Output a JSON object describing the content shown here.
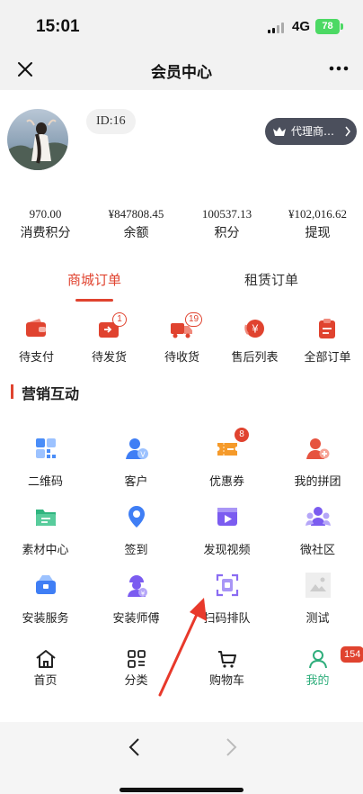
{
  "status_bar": {
    "time": "15:01",
    "network": "4G",
    "battery": "78"
  },
  "nav": {
    "title": "会员中心",
    "close_icon": "close-icon",
    "more_icon": "more-icon"
  },
  "profile": {
    "id_label": "ID:16",
    "agent_button": "代理商…"
  },
  "stats": [
    {
      "value": "970.00",
      "label": "消费积分"
    },
    {
      "value": "¥847808.45",
      "label": "余额"
    },
    {
      "value": "100537.13",
      "label": "积分"
    },
    {
      "value": "¥102,016.62",
      "label": "提现"
    }
  ],
  "order_tabs": {
    "active": "商城订单",
    "inactive": "租赁订单"
  },
  "orders": [
    {
      "label": "待支付",
      "icon": "wallet-icon"
    },
    {
      "label": "待发货",
      "icon": "box-icon",
      "badge": "1"
    },
    {
      "label": "待收货",
      "icon": "truck-icon",
      "badge": "19"
    },
    {
      "label": "售后列表",
      "icon": "refund-icon"
    },
    {
      "label": "全部订单",
      "icon": "clipboard-icon"
    }
  ],
  "marketing": {
    "title": "营销互动",
    "items": [
      {
        "label": "二维码",
        "icon": "qrcode-icon"
      },
      {
        "label": "客户",
        "icon": "customer-icon"
      },
      {
        "label": "优惠券",
        "icon": "coupon-icon",
        "badge": "8"
      },
      {
        "label": "我的拼团",
        "icon": "group-buy-icon"
      },
      {
        "label": "素材中心",
        "icon": "folder-icon"
      },
      {
        "label": "签到",
        "icon": "location-pin-icon"
      },
      {
        "label": "发现视频",
        "icon": "video-icon"
      },
      {
        "label": "微社区",
        "icon": "community-icon"
      },
      {
        "label": "安装服务",
        "icon": "install-box-icon"
      },
      {
        "label": "安装师傅",
        "icon": "worker-icon"
      },
      {
        "label": "扫码排队",
        "icon": "scan-icon"
      },
      {
        "label": "测试",
        "icon": "image-placeholder-icon"
      }
    ]
  },
  "tabbar": {
    "items": [
      {
        "label": "首页",
        "icon": "home-icon"
      },
      {
        "label": "分类",
        "icon": "category-icon"
      },
      {
        "label": "购物车",
        "icon": "cart-icon"
      },
      {
        "label": "我的",
        "icon": "user-icon"
      }
    ],
    "badge": "154"
  },
  "colors": {
    "accent": "#e0432f",
    "active_tab": "#2fae7c",
    "header_bg": "#f2f2f2"
  }
}
